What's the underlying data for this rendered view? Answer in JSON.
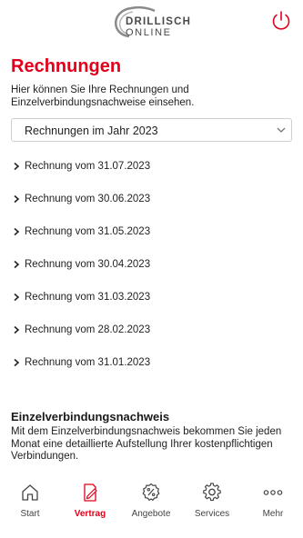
{
  "header": {
    "logo_line1": "DRILLISCH",
    "logo_line2": "ONLINE"
  },
  "page": {
    "title": "Rechnungen",
    "intro": "Hier können Sie Ihre Rechnungen und Einzelverbindungsnachweise einsehen."
  },
  "year_select": {
    "selected": "Rechnungen im Jahr 2023"
  },
  "invoices": [
    "Rechnung vom 31.07.2023",
    "Rechnung vom 30.06.2023",
    "Rechnung vom 31.05.2023",
    "Rechnung vom 30.04.2023",
    "Rechnung vom 31.03.2023",
    "Rechnung vom 28.02.2023",
    "Rechnung vom 31.01.2023"
  ],
  "evn": {
    "title": "Einzelverbindungsnachweis",
    "text": "Mit dem Einzelverbindungsnachweis bekommen Sie jeden Monat eine detaillierte Aufstellung Ihrer kostenpflichtigen Verbindungen."
  },
  "nav": {
    "items": [
      {
        "label": "Start",
        "icon": "home-icon"
      },
      {
        "label": "Vertrag",
        "icon": "contract-icon",
        "active": true
      },
      {
        "label": "Angebote",
        "icon": "percent-badge-icon"
      },
      {
        "label": "Services",
        "icon": "gear-icon"
      },
      {
        "label": "Mehr",
        "icon": "more-dots-icon"
      }
    ]
  },
  "colors": {
    "brand_red": "#e2001a",
    "text": "#222222",
    "logo_grey": "#4a4a4a"
  }
}
